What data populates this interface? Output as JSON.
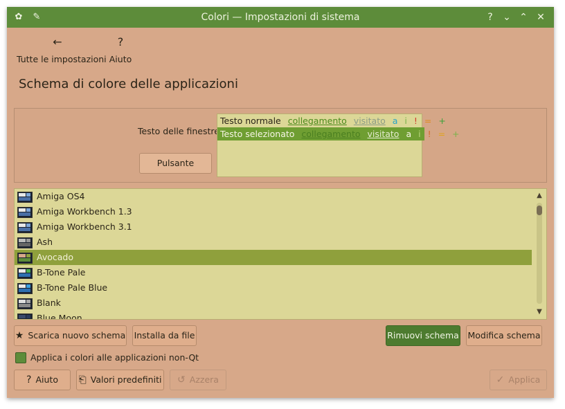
{
  "window": {
    "title": "Colori — Impostazioni di sistema",
    "icon": "settings-app-icon",
    "pin_icon": "pin-icon",
    "controls": {
      "help": "?",
      "minimize": "⌄",
      "maximize": "⌃",
      "close": "✕"
    }
  },
  "toolbar": {
    "all_settings": {
      "icon": "←",
      "label": "Tutte le impostazioni"
    },
    "help": {
      "icon": "?",
      "label": "Aiuto"
    }
  },
  "page_title": "Schema di colore delle applicazioni",
  "preview": {
    "window_text_label": "Testo delle finestre",
    "button_label": "Pulsante",
    "normal_row": {
      "text": "Testo normale",
      "link": "collegamento",
      "visited": "visitato",
      "a": "a",
      "i": "i",
      "excl": "!",
      "eq": "=",
      "plus": "+"
    },
    "selected_row": {
      "text": "Testo selezionato",
      "link": "collegamento",
      "visited": "visitato",
      "a": "a",
      "i": "i",
      "excl": "!",
      "eq": "=",
      "plus": "+"
    }
  },
  "schemes": [
    {
      "name": "Amiga OS4"
    },
    {
      "name": "Amiga Workbench 1.3"
    },
    {
      "name": "Amiga Workbench 3.1"
    },
    {
      "name": "Ash"
    },
    {
      "name": "Avocado",
      "selected": true
    },
    {
      "name": "B-Tone Pale"
    },
    {
      "name": "B-Tone Pale Blue"
    },
    {
      "name": "Blank"
    },
    {
      "name": "Blue Moon"
    }
  ],
  "actions": {
    "download": {
      "icon": "★",
      "label": "Scarica nuovo schema"
    },
    "install": {
      "label": "Installa da file"
    },
    "remove": {
      "label": "Rimuovi schema"
    },
    "edit": {
      "label": "Modifica schema"
    }
  },
  "apply_non_qt": {
    "label": "Applica i colori alle applicazioni non-Qt",
    "checked": true
  },
  "footer": {
    "help": {
      "icon": "?",
      "label": "Aiuto"
    },
    "defaults": {
      "icon": "⎗",
      "label": "Valori predefiniti"
    },
    "reset": {
      "icon": "↺",
      "label": "Azzera"
    },
    "apply": {
      "icon": "✓",
      "label": "Applica"
    }
  },
  "colors": {
    "titlebar": "#5d8c3a",
    "window_bg": "#d7a889",
    "view_bg": "#dcd797",
    "selection": "#8fa03c",
    "accent_button": "#4d7b2f"
  }
}
